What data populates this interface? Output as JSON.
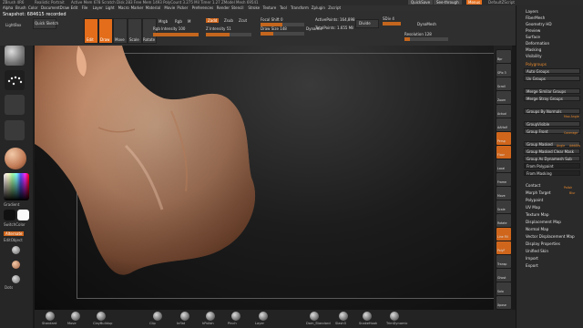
{
  "titlebar": {
    "app": "ZBrush 4R6",
    "doc": "Realistic Portrait",
    "status": "Active Mem 678  Scratch Disk 283  Free Mem 1493  PolyCount 3.275 Mil  Timer 1.27  ZModel Mesh 69541",
    "quicksave": "QuickSave",
    "seethrough": "See-through",
    "menus": "Menus",
    "script": "DefaultZScript"
  },
  "menubar": {
    "items": [
      "Alpha",
      "Brush",
      "Color",
      "Document",
      "Draw",
      "Edit",
      "File",
      "Layer",
      "Light",
      "Macro",
      "Marker",
      "Material",
      "Movie",
      "Picker",
      "Preferences",
      "Render",
      "Stencil",
      "Stroke",
      "Texture",
      "Tool",
      "Transform",
      "Zplugin",
      "Zscript"
    ]
  },
  "notice": "Snapshot: 684615 recorded",
  "toolbar": {
    "lightbox": "LightBox",
    "quicksketch": "Quick Sketch",
    "edit": "Edit",
    "draw": "Draw",
    "move": "Move",
    "scale": "Scale",
    "rotate": "Rotate",
    "mrgb": "Mrgb",
    "rgb": "Rgb",
    "m": "M",
    "rgb_intensity": "Rgb Intensity 100",
    "zadd": "Zadd",
    "zsub": "Zsub",
    "zcut": "Zcut",
    "z_intensity": "Z Intensity 51",
    "focal_shift": "Focal Shift 0",
    "draw_size": "Draw Size 148",
    "dynamic": "Dynamic",
    "active_points": "ActivePoints: 164,898",
    "total_points": "TotalPoints: 1.655 Mil",
    "divide": "Divide",
    "sdiv": "SDiv 4",
    "dynamesh": "DynaMesh",
    "resolution": "Resolution 128"
  },
  "lefttray": {
    "gradient": "Gradient",
    "switchcolor": "SwitchColor",
    "alternate": "Alternate",
    "editobject": "EditObject",
    "dots": "Dots",
    "material": "Material"
  },
  "righticons": [
    "Bpr",
    "SPix 3",
    "Scroll",
    "Zoom",
    "Actual",
    "AAHalf",
    "Persp",
    "Floor",
    "Local",
    "Frame",
    "Move",
    "Scale",
    "Rotate",
    "Line Fill",
    "PolyF",
    "Transp",
    "Ghost",
    "Solo",
    "Xpose"
  ],
  "palette": {
    "top_items": [
      "Layers",
      "FiberMesh",
      "Geometry HD",
      "Preview",
      "Surface",
      "Deformation",
      "Masking",
      "Visibility"
    ],
    "polygroups_title": "Polygroups",
    "polygroup_buttons": [
      "Auto Groups",
      "Uv Groups",
      "Merge Similar Groups",
      "Merge Stray Groups",
      "Groups By Normals",
      "GroupVisible",
      "Group Front",
      "Group Masked",
      "Group Masked Clear Mask",
      "Group As Dynamesh Sub",
      "From Polypaint",
      "From Masking"
    ],
    "slider_labels": [
      "Max Angle",
      "Coverage",
      "Angle",
      "AddAlts",
      "Polish",
      "Blur"
    ],
    "bottom_items": [
      "Contact",
      "Morph Target",
      "Polypaint",
      "UV Map",
      "Texture Map",
      "Displacement Map",
      "Normal Map",
      "Vector Displacement Map",
      "Display Properties",
      "Unified Skin",
      "Import",
      "Export"
    ]
  },
  "shelf": {
    "items": [
      "Standard",
      "Move",
      "ClayBuildup",
      "Clip",
      "Inflat",
      "hPolish",
      "Pinch",
      "Layer",
      "Dam_Standard",
      "Slash3",
      "SnakeHook",
      "TrimDynamic"
    ]
  },
  "colors": {
    "accent": "#e36d1b",
    "skin": "#d9a07d",
    "bg": "#1a1a1a"
  }
}
